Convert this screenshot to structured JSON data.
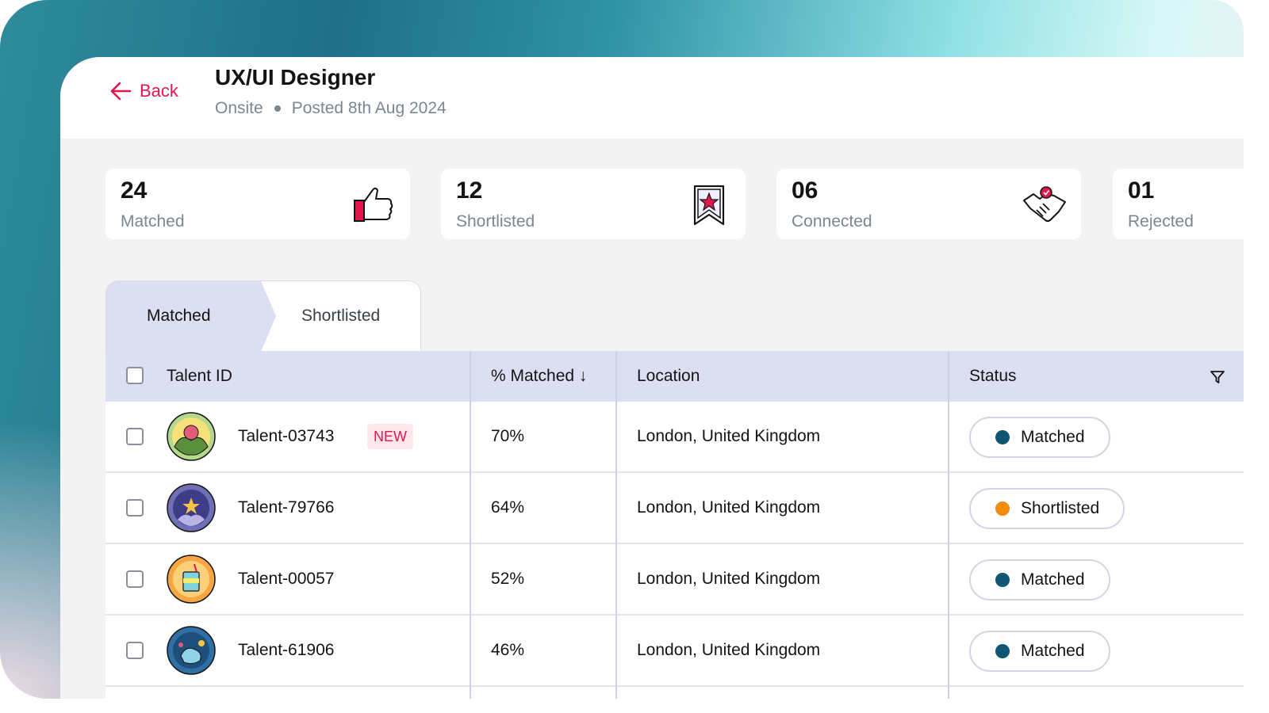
{
  "header": {
    "back_label": "Back",
    "job_title": "UX/UI Designer",
    "work_type": "Onsite",
    "posted": "Posted 8th Aug 2024"
  },
  "stats": [
    {
      "value": "24",
      "label": "Matched",
      "icon": "thumbs-up-icon"
    },
    {
      "value": "12",
      "label": "Shortlisted",
      "icon": "bookmark-star-icon"
    },
    {
      "value": "06",
      "label": "Connected",
      "icon": "handshake-icon"
    },
    {
      "value": "01",
      "label": "Rejected",
      "icon": ""
    }
  ],
  "tabs": [
    {
      "label": "Matched",
      "active": true
    },
    {
      "label": "Shortlisted",
      "active": false
    }
  ],
  "table": {
    "columns": {
      "talent_id": "Talent ID",
      "matched": "% Matched ↓",
      "location": "Location",
      "status": "Status"
    },
    "rows": [
      {
        "id": "Talent-03743",
        "new_badge": "NEW",
        "matched": "70%",
        "location": "London, United Kingdom",
        "status": "Matched",
        "status_color": "#0e5674",
        "avatar": "imaginative-badge-icon"
      },
      {
        "id": "Talent-79766",
        "new_badge": "",
        "matched": "64%",
        "location": "London, United Kingdom",
        "status": "Shortlisted",
        "status_color": "#f28c0f",
        "avatar": "positive-badge-icon"
      },
      {
        "id": "Talent-00057",
        "new_badge": "",
        "matched": "52%",
        "location": "London, United Kingdom",
        "status": "Matched",
        "status_color": "#0e5674",
        "avatar": "optimistic-badge-icon"
      },
      {
        "id": "Talent-61906",
        "new_badge": "",
        "matched": "46%",
        "location": "London, United Kingdom",
        "status": "Matched",
        "status_color": "#0e5674",
        "avatar": "happy-badge-icon"
      }
    ]
  },
  "colors": {
    "accent": "#e0164d",
    "header_bg": "#dcdff2"
  }
}
